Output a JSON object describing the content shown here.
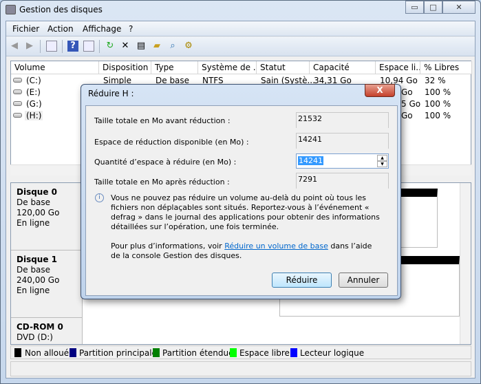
{
  "window": {
    "title": "Gestion des disques",
    "minimize": "▭",
    "maximize": "□",
    "close": "✕"
  },
  "menu": [
    "Fichier",
    "Action",
    "Affichage",
    "?"
  ],
  "toolbar": {
    "icons": [
      "back-icon",
      "forward-icon",
      "show-hide-tree-icon",
      "help-icon",
      "show-hide-action-icon",
      "refresh-icon",
      "delete-icon",
      "properties-icon",
      "open-icon",
      "explore-icon",
      "settings-icon"
    ]
  },
  "columns": [
    "Volume",
    "Disposition",
    "Type",
    "Système de ...",
    "Statut",
    "Capacité",
    "Espace li...",
    "% Libres"
  ],
  "rows": [
    {
      "volume": "(C:)",
      "disposition": "Simple",
      "type": "De base",
      "fs": "NTFS",
      "status": "Sain (Systè...",
      "capacity": "34,31 Go",
      "free": "10,94 Go",
      "pct": "32 %"
    },
    {
      "volume": "(E:)",
      "free": "Go",
      "pct": "100 %"
    },
    {
      "volume": "(G:)",
      "free": "5 Go",
      "pct": "100 %"
    },
    {
      "volume": "(H:)",
      "free": "Go",
      "pct": "100 %"
    }
  ],
  "disks": [
    {
      "name": "Disque 0",
      "type": "De base",
      "size": "120,00 Go",
      "state": "En ligne"
    },
    {
      "name": "Disque 1",
      "type": "De base",
      "size": "240,00 Go",
      "state": "En ligne"
    },
    {
      "name": "CD-ROM 0",
      "type": "DVD (D:)"
    }
  ],
  "legend": [
    {
      "label": "Non alloué",
      "color": "#000000"
    },
    {
      "label": "Partition principale",
      "color": "#000080"
    },
    {
      "label": "Partition étendue",
      "color": "#008000"
    },
    {
      "label": "Espace libre",
      "color": "#00ff00"
    },
    {
      "label": "Lecteur logique",
      "color": "#0000ff"
    }
  ],
  "dialog": {
    "title": "Réduire H :",
    "close": "X",
    "fields": [
      {
        "label": "Taille totale en Mo avant réduction :",
        "value": "21532"
      },
      {
        "label": "Espace de réduction disponible (en Mo) :",
        "value": "14241"
      },
      {
        "label": "Quantité d’espace à réduire (en Mo) :",
        "value": "14241"
      },
      {
        "label": "Taille totale en Mo après réduction :",
        "value": "7291"
      }
    ],
    "info": "Vous ne pouvez pas réduire un volume au-delà du point où tous les fichiers non déplaçables sont situés. Reportez-vous à l’événement « defrag » dans le journal des applications pour obtenir des informations détaillées sur l’opération, une fois terminée.",
    "more_prefix": "Pour plus d’informations, voir ",
    "more_link": "Réduire un volume de base",
    "more_suffix": " dans l’aide de la console Gestion des disques.",
    "ok": "Réduire",
    "cancel": "Annuler"
  }
}
